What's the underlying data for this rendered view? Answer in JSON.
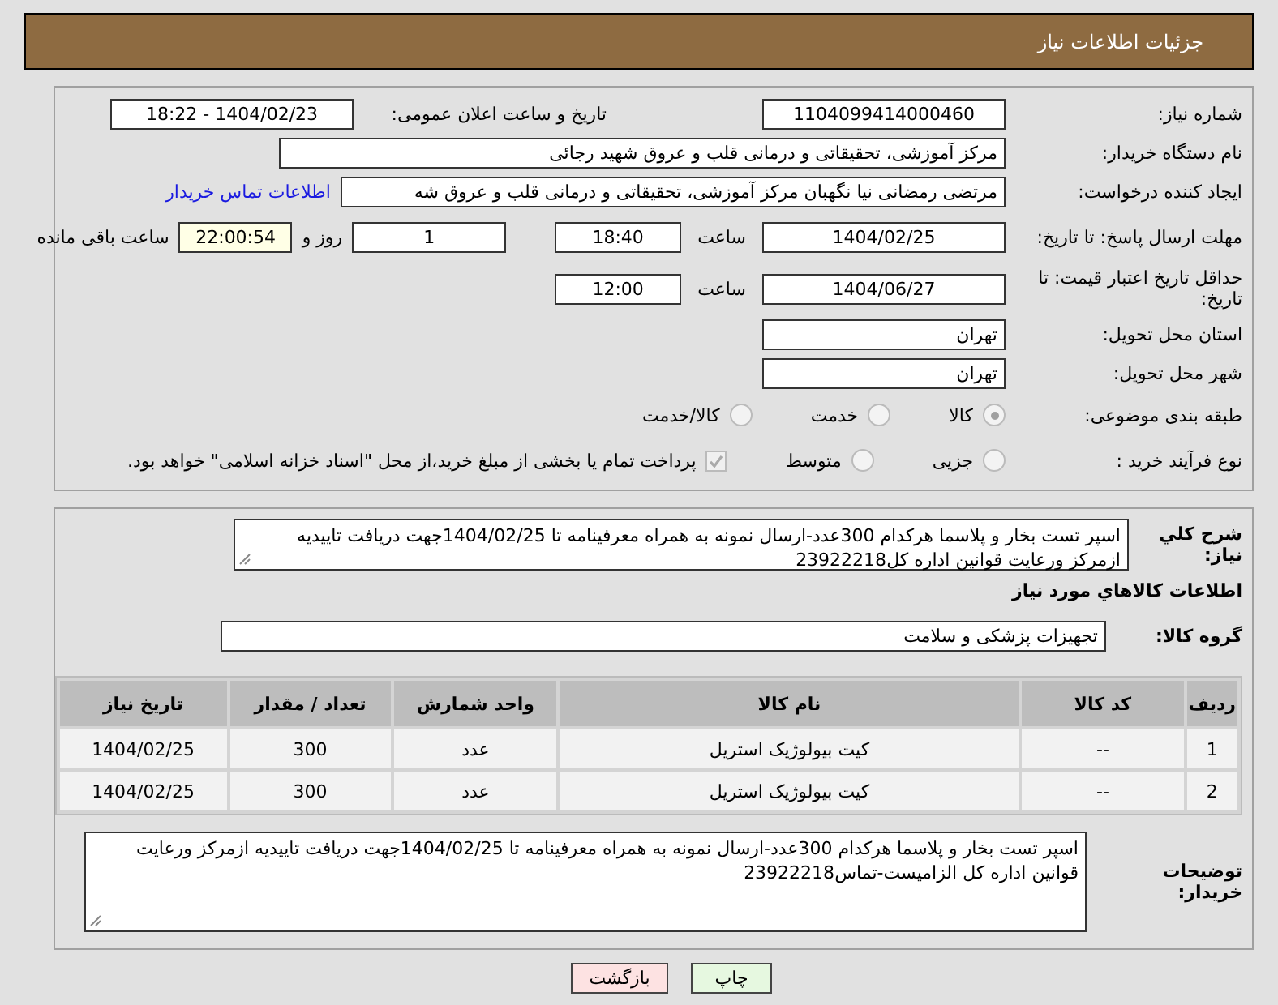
{
  "header": {
    "title": "جزئیات اطلاعات نیاز"
  },
  "need_number": {
    "label": "شماره نیاز:",
    "value": "1104099414000460"
  },
  "announce": {
    "label": "تاریخ و ساعت اعلان عمومی:",
    "value": "1404/02/23 - 18:22"
  },
  "buyer": {
    "label": "نام دستگاه خریدار:",
    "value": "مرکز آموزشی، تحقیقاتی و درمانی قلب و عروق شهید رجائی"
  },
  "requester": {
    "label": "ایجاد کننده درخواست:",
    "value": "مرتضی رمضانی نیا نگهبان مرکز آموزشی، تحقیقاتی و درمانی قلب و عروق شه",
    "link": "اطلاعات تماس خریدار"
  },
  "deadline": {
    "label": "مهلت ارسال پاسخ: تا تاریخ:",
    "date": "1404/02/25",
    "time_label": "ساعت",
    "time": "18:40",
    "days": "1",
    "days_label": "روز و",
    "remaining": "22:00:54",
    "remaining_label": "ساعت باقی مانده"
  },
  "validity": {
    "label": "حداقل تاریخ اعتبار قیمت: تا تاریخ:",
    "date": "1404/06/27",
    "time_label": "ساعت",
    "time": "12:00"
  },
  "province": {
    "label": "استان محل تحویل:",
    "value": "تهران"
  },
  "city": {
    "label": "شهر محل تحویل:",
    "value": "تهران"
  },
  "category": {
    "label": "طبقه بندی موضوعی:",
    "options": [
      {
        "label": "کالا",
        "selected": true
      },
      {
        "label": "خدمت",
        "selected": false
      },
      {
        "label": "کالا/خدمت",
        "selected": false
      }
    ]
  },
  "process": {
    "label": "نوع فرآیند خرید :",
    "options": [
      {
        "label": "جزیی",
        "selected": false
      },
      {
        "label": "متوسط",
        "selected": false
      }
    ],
    "payment": {
      "label": "پرداخت تمام یا بخشی از مبلغ خرید،از محل \"اسناد خزانه اسلامی\" خواهد بود.",
      "checked": true
    }
  },
  "description": {
    "label": "شرح کلي نياز:",
    "value": "اسپر تست بخار و پلاسما هرکدام 300عدد-ارسال نمونه به همراه معرفینامه تا 1404/02/25جهت دریافت تاییدیه ازمرکز ورعایت قوانین اداره کل23922218"
  },
  "items_title": "اطلاعات کالاهاي مورد نياز",
  "goods_group": {
    "label": "گروه کالا:",
    "value": "تجهیزات پزشکی و سلامت"
  },
  "table": {
    "columns": [
      "ردیف",
      "کد کالا",
      "نام کالا",
      "واحد شمارش",
      "تعداد / مقدار",
      "تاریخ نیاز"
    ],
    "rows": [
      [
        "1",
        "--",
        "کیت بیولوژیک استریل",
        "عدد",
        "300",
        "1404/02/25"
      ],
      [
        "2",
        "--",
        "کیت بیولوژیک استریل",
        "عدد",
        "300",
        "1404/02/25"
      ]
    ]
  },
  "buyer_notes": {
    "label": "توضیحات خریدار:",
    "value": "اسپر تست بخار و پلاسما هرکدام 300عدد-ارسال نمونه به همراه معرفینامه تا 1404/02/25جهت دریافت تاییدیه ازمرکز ورعایت قوانین اداره کل الزامیست-تماس23922218"
  },
  "buttons": [
    {
      "label": "چاپ",
      "kind": "print"
    },
    {
      "label": "بازگشت",
      "kind": "back"
    }
  ]
}
